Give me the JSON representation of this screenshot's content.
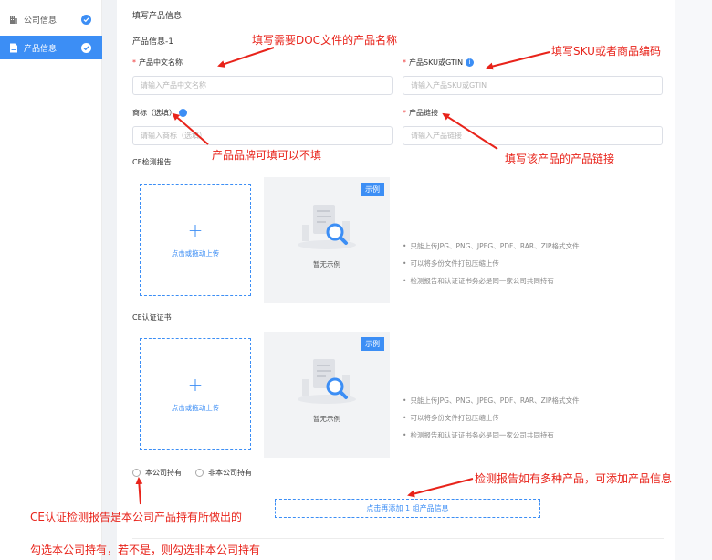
{
  "sidebar": {
    "items": [
      {
        "label": "公司信息",
        "active": false
      },
      {
        "label": "产品信息",
        "active": true
      }
    ]
  },
  "form": {
    "section_title": "填写产品信息",
    "group_title": "产品信息-1",
    "cn_name": {
      "label": "产品中文名称",
      "placeholder": "请输入产品中文名称"
    },
    "sku": {
      "label": "产品SKU或GTIN",
      "placeholder": "请输入产品SKU或GTIN"
    },
    "brand": {
      "label": "商标（选填）",
      "placeholder": "请输入商标（选填）"
    },
    "link": {
      "label": "产品链接",
      "placeholder": "请输入产品链接"
    },
    "ce_report": {
      "label": "CE检测报告"
    },
    "ce_cert": {
      "label": "CE认证证书"
    },
    "upload_text": "点击或拖动上传",
    "example_tag": "示例",
    "no_example": "暂无示例",
    "tips": [
      "只能上传JPG、PNG、JPEG、PDF、RAR、ZIP格式文件",
      "可以将多份文件打包压缩上传",
      "检测报告和认证证书务必是同一家公司共同持有"
    ],
    "radio_own": "本公司持有",
    "radio_other": "非本公司持有",
    "add_button": "点击再添加 1 组产品信息"
  },
  "annotations": {
    "doc_name": "填写需要DOC文件的产品名称",
    "sku": "填写SKU或者商品编码",
    "brand": "产品品牌可填可以不填",
    "link": "填写该产品的产品链接",
    "add_more": "检测报告如有多种产品，可添加产品信息",
    "ce_line1": "CE认证检测报告是本公司产品持有所做出的",
    "ce_line2": "勾选本公司持有，若不是，则勾选非本公司持有"
  },
  "colors": {
    "accent": "#3c8ef5",
    "annotation": "#e8231a"
  }
}
